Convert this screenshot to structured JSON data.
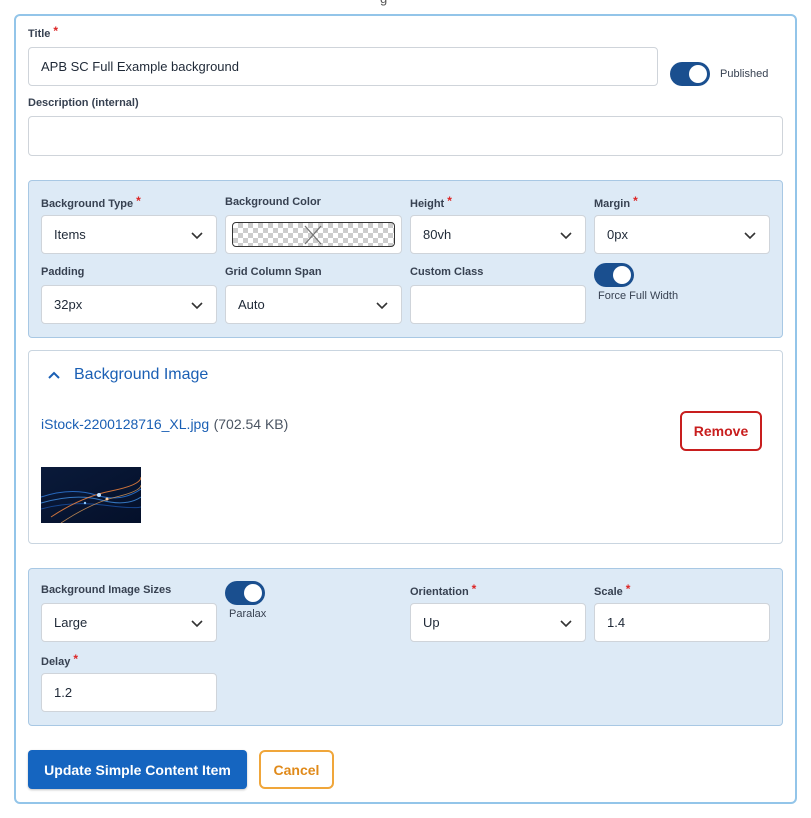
{
  "form": {
    "title": {
      "label": "Title",
      "value": "APB SC Full Example background"
    },
    "published": {
      "label": "Published",
      "on": true
    },
    "description": {
      "label": "Description (internal)",
      "value": ""
    },
    "settings": {
      "background_type": {
        "label": "Background Type",
        "value": "Items"
      },
      "background_color": {
        "label": "Background Color"
      },
      "height": {
        "label": "Height",
        "value": "80vh"
      },
      "margin": {
        "label": "Margin",
        "value": "0px"
      },
      "padding": {
        "label": "Padding",
        "value": "32px"
      },
      "grid_column_span": {
        "label": "Grid Column Span",
        "value": "Auto"
      },
      "custom_class": {
        "label": "Custom Class",
        "value": ""
      },
      "force_full_width": {
        "label": "Force Full Width",
        "on": true
      }
    },
    "background_image": {
      "title": "Background Image",
      "file_name": "iStock-2200128716_XL.jpg",
      "file_size": "(702.54 KB)",
      "remove_label": "Remove"
    },
    "image_settings": {
      "sizes": {
        "label": "Background Image Sizes",
        "value": "Large"
      },
      "paralax": {
        "label": "Paralax",
        "on": true
      },
      "orientation": {
        "label": "Orientation",
        "value": "Up"
      },
      "scale": {
        "label": "Scale",
        "value": "1.4"
      },
      "delay": {
        "label": "Delay",
        "value": "1.2"
      }
    },
    "actions": {
      "update_label": "Update Simple Content Item",
      "cancel_label": "Cancel"
    }
  },
  "colors": {
    "accent": "#1565c0",
    "toggle": "#1a4f8f",
    "danger": "#c81e1e",
    "warning": "#f0a63a",
    "panel": "#ddeaf6"
  }
}
